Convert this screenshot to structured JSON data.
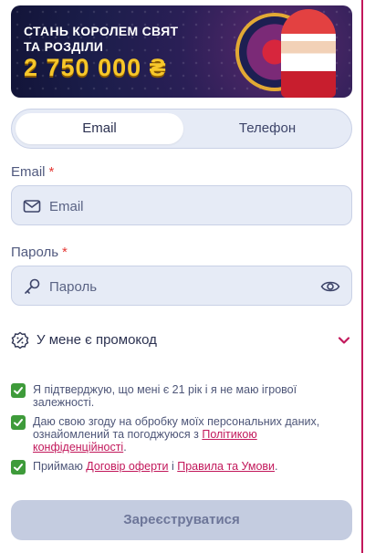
{
  "banner": {
    "line1": "СТАНЬ КОРОЛЕМ СВЯТ",
    "line2": "ТА РОЗДІЛИ",
    "amount": "2 750 000 ₴"
  },
  "tabs": [
    {
      "label": "Email",
      "active": true
    },
    {
      "label": "Телефон",
      "active": false
    }
  ],
  "email": {
    "label": "Email",
    "required_mark": "*",
    "placeholder": "Email",
    "value": ""
  },
  "password": {
    "label": "Пароль",
    "required_mark": "*",
    "placeholder": "Пароль",
    "value": ""
  },
  "promo": {
    "label": "У мене є  промокод"
  },
  "checkboxes": [
    {
      "checked": true,
      "text": "Я підтверджую, що мені є 21 рік і я не маю ігрової залежності."
    },
    {
      "checked": true,
      "text": "Даю свою згоду на обробку моїх персональних даних, ознайомлений та погоджуюся з ",
      "link": "Політикою конфіденційності",
      "tail": "."
    },
    {
      "checked": true,
      "text": "Приймаю ",
      "link1": "Договір оферти",
      "middle": " і ",
      "link2": "Правила та Умови",
      "tail": "."
    }
  ],
  "submit": {
    "label": "Зареєструватися"
  },
  "colors": {
    "accent": "#c2185b",
    "field_bg": "#e6ebf6",
    "checkbox": "#3e9b3a",
    "button_disabled": "#c4cce0"
  },
  "icons": [
    "envelope-icon",
    "key-icon",
    "eye-icon",
    "promo-badge-icon",
    "chevron-down-icon",
    "checkmark-icon"
  ]
}
